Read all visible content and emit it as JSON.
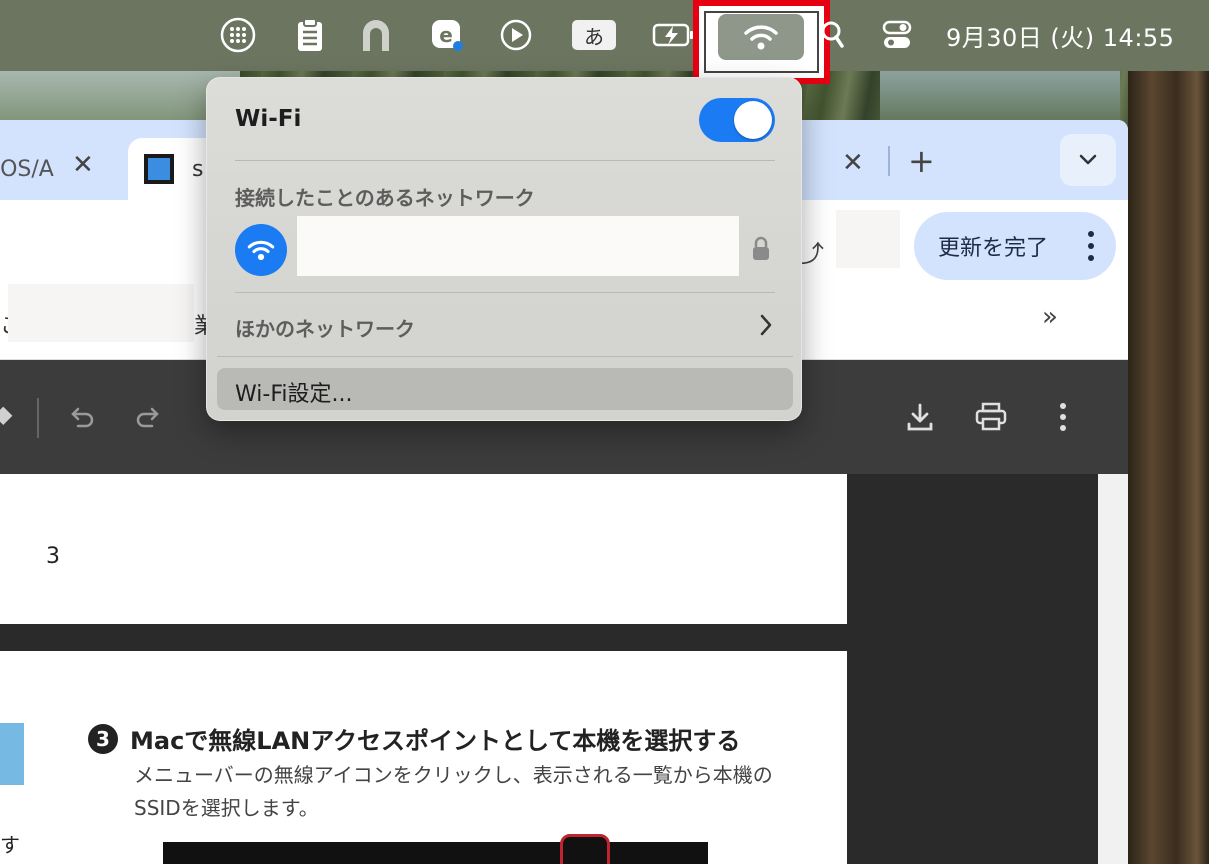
{
  "menubar": {
    "ime_label": "あ",
    "clock": "9月30日 (火)  14:55",
    "icons": [
      "launchpad-icon",
      "clipboard-icon",
      "arch-icon",
      "e-app-icon",
      "play-icon",
      "ime-icon",
      "battery-charging-icon",
      "wifi-icon",
      "search-icon",
      "control-center-icon"
    ]
  },
  "browser": {
    "tabs": [
      {
        "title": "iOS/A"
      },
      {
        "title": "s"
      }
    ],
    "update_button": "更新を完了",
    "bookmarks": {
      "left_char": "こ",
      "mid_char": "業",
      "more": "»"
    },
    "pdf": {
      "page_number": "3",
      "step_number": "3",
      "step_title": "Macで無線LANアクセスポイントとして本機を選択する",
      "step_desc": "メニューバーの無線アイコンをクリックし、表示される一覧から本機のSSIDを選択します。",
      "left_fragment": "す"
    }
  },
  "wifi_menu": {
    "title": "Wi-Fi",
    "toggle_on": true,
    "known_networks_header": "接続したことのあるネットワーク",
    "other_networks": "ほかのネットワーク",
    "settings": "Wi-Fi設定..."
  },
  "colors": {
    "accent": "#1a7bf2",
    "highlight_red": "#e60012",
    "menubar": "#6c7560"
  }
}
